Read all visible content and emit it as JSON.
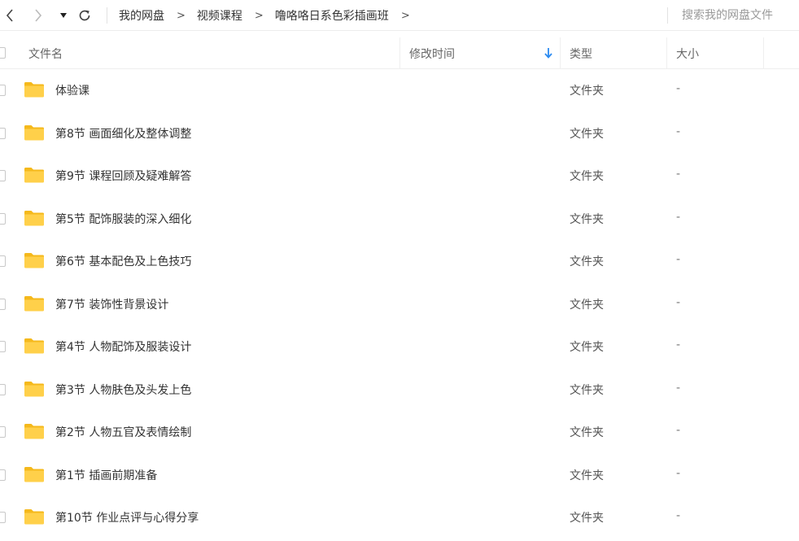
{
  "toolbar": {
    "breadcrumb": [
      "我的网盘",
      "视频课程",
      "噜咯咯日系色彩插画班"
    ],
    "crumb_sep": ">",
    "search_placeholder": "搜索我的网盘文件"
  },
  "columns": {
    "name": "文件名",
    "modified": "修改时间",
    "type": "类型",
    "size": "大小"
  },
  "files": [
    {
      "name": "体验课",
      "type": "文件夹",
      "size": "-"
    },
    {
      "name": "第8节 画面细化及整体调整",
      "type": "文件夹",
      "size": "-"
    },
    {
      "name": "第9节 课程回顾及疑难解答",
      "type": "文件夹",
      "size": "-"
    },
    {
      "name": "第5节 配饰服装的深入细化",
      "type": "文件夹",
      "size": "-"
    },
    {
      "name": "第6节 基本配色及上色技巧",
      "type": "文件夹",
      "size": "-"
    },
    {
      "name": "第7节 装饰性背景设计",
      "type": "文件夹",
      "size": "-"
    },
    {
      "name": "第4节 人物配饰及服装设计",
      "type": "文件夹",
      "size": "-"
    },
    {
      "name": "第3节 人物肤色及头发上色",
      "type": "文件夹",
      "size": "-"
    },
    {
      "name": "第2节 人物五官及表情绘制",
      "type": "文件夹",
      "size": "-"
    },
    {
      "name": "第1节 插画前期准备",
      "type": "文件夹",
      "size": "-"
    },
    {
      "name": "第10节 作业点评与心得分享",
      "type": "文件夹",
      "size": "-"
    }
  ],
  "colors": {
    "folder": "#FFD04A",
    "folder_tab": "#F5B91C",
    "sort_arrow": "#2B8AF0"
  }
}
